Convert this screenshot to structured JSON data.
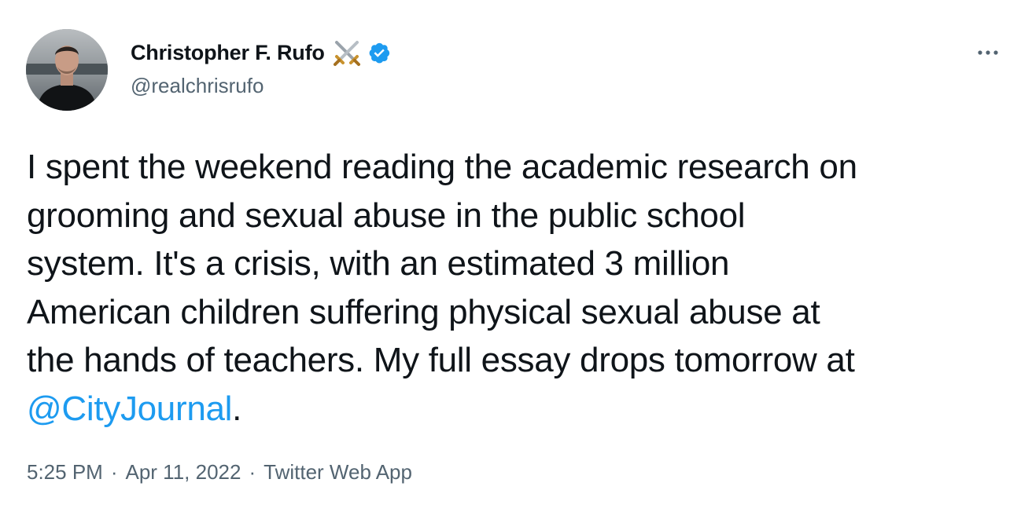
{
  "author": {
    "display_name": "Christopher F. Rufo",
    "handle": "@realchrisrufo",
    "badge_emoji_icon": "crossed-swords-icon",
    "verified_icon": "verified-badge-icon"
  },
  "more_icon": "more-horizontal-icon",
  "tweet": {
    "lines": [
      "I spent the weekend reading the academic research on",
      "grooming and sexual abuse in the public school",
      "system. It's a crisis, with an estimated 3 million",
      "American children suffering physical sexual abuse at",
      "the hands of teachers. My full essay drops tomorrow at"
    ],
    "mention": "@CityJournal",
    "trailing": "."
  },
  "meta": {
    "time": "5:25 PM",
    "separator": "·",
    "date": "Apr 11, 2022",
    "source": "Twitter Web App"
  },
  "colors": {
    "link": "#1d9bf0",
    "secondary_text": "#536471",
    "primary_text": "#0f1419"
  }
}
